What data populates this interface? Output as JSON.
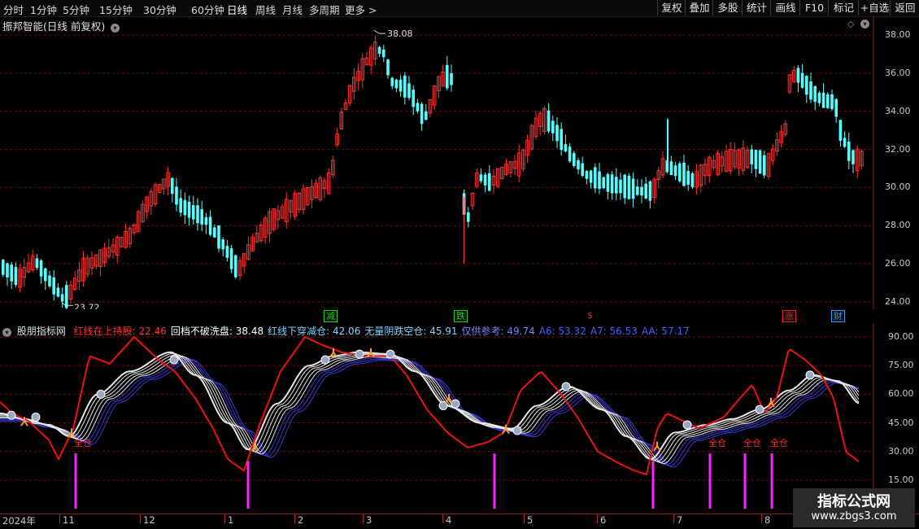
{
  "toolbar": {
    "periods": [
      "分时",
      "1分钟",
      "5分钟",
      "15分钟",
      "30分钟",
      "60分钟",
      "日线",
      "周线",
      "月线",
      "多周期",
      "更多 >"
    ],
    "active_period": "日线",
    "buttons": [
      "复权",
      "叠加",
      "多股",
      "统计",
      "画线",
      "F10",
      "标记",
      "+自选",
      "返回"
    ]
  },
  "price_panel": {
    "title": "振邦智能(日线 前复权)",
    "high_label": "38.08",
    "low_label": "23.72",
    "y_ticks": [
      "38.00",
      "36.00",
      "34.00",
      "32.00",
      "30.00",
      "28.00",
      "26.00",
      "24.00"
    ],
    "markers": [
      {
        "text": "减",
        "color": "#22cc22",
        "kind": "box"
      },
      {
        "text": "跌",
        "color": "#22cc22",
        "kind": "box"
      },
      {
        "text": "$",
        "color": "#ee2222",
        "kind": "plain"
      },
      {
        "text": "涨",
        "color": "#ee2222",
        "kind": "box"
      },
      {
        "text": "财",
        "color": "#3399ff",
        "kind": "box"
      }
    ]
  },
  "indicator_panel": {
    "name": "股朋指标网",
    "legend": [
      {
        "label": "红线在上持股:",
        "value": "22.46",
        "color": "#ff3333"
      },
      {
        "label": "回档不破洗盘:",
        "value": "38.48",
        "color": "#ffffff"
      },
      {
        "label": "红线下穿减仓:",
        "value": "42.06",
        "color": "#7fd4ff"
      },
      {
        "label": "无量阴跌空仓:",
        "value": "45.91",
        "color": "#7fd4ff"
      },
      {
        "label": "仅供参考:",
        "value": "49.74",
        "color": "#8080ff"
      },
      {
        "label": "A6:",
        "value": "53.32",
        "color": "#4060ff"
      },
      {
        "label": "A7:",
        "value": "56.53",
        "color": "#4060ff"
      },
      {
        "label": "AA:",
        "value": "57.17",
        "color": "#4060ff"
      }
    ],
    "y_ticks": [
      "90.00",
      "75.00",
      "60.00",
      "45.00",
      "30.00",
      "15.00"
    ],
    "signal_label": "全仓"
  },
  "time_axis": {
    "labels": [
      "2024年",
      "11",
      "12",
      "1",
      "2",
      "3",
      "4",
      "5",
      "6",
      "7",
      "8"
    ]
  },
  "watermark": {
    "title": "指标公式网",
    "url": "www.zbgs3.com"
  },
  "colors": {
    "up": "#ff3030",
    "down": "#54ffff",
    "grid": "#6a1010",
    "red_line": "#ee1111",
    "white_line": "#ffffff",
    "blue_line": "#3b3bd8",
    "signal_bar": "#ff22ff"
  }
}
